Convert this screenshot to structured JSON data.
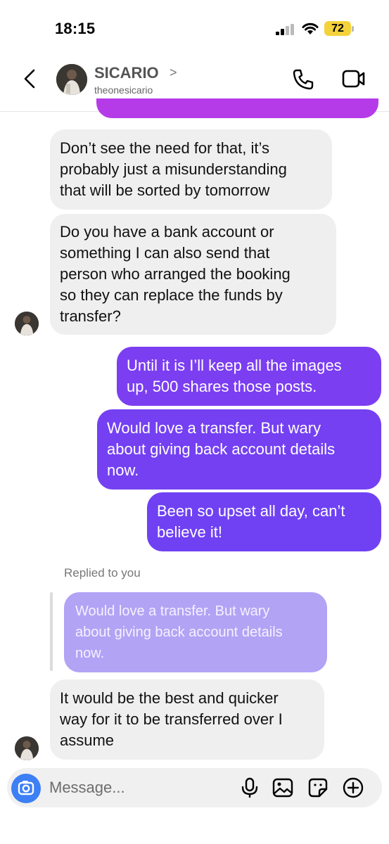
{
  "status_bar": {
    "time": "18:15",
    "battery": "72"
  },
  "header": {
    "name": "SICARIO",
    "chevron": ">",
    "username": "theonesicario"
  },
  "messages": [
    {
      "from": "them",
      "text": "Don’t see the need for that, it’s\nprobably just a misunderstanding\nthat will be sorted by tomorrow"
    },
    {
      "from": "them",
      "text": "Do you have a bank account or\nsomething I can also send that\nperson who arranged the booking\nso they can replace the funds by\ntransfer?"
    },
    {
      "from": "me",
      "text": "Until it is I’ll keep all the images\nup, 500 shares those posts."
    },
    {
      "from": "me",
      "text": "Would love a transfer. But wary\nabout giving back account details\nnow."
    },
    {
      "from": "me",
      "text": "Been so upset all day, can’t\nbelieve it!"
    },
    {
      "from": "them",
      "text": "It would be the best and quicker\nway for it to be transferred over I\nassume"
    }
  ],
  "reply": {
    "label": "Replied to you",
    "quoted_text": "Would love a transfer. But wary\nabout giving back account details\nnow."
  },
  "composer": {
    "placeholder": "Message..."
  },
  "colors": {
    "outgoing": "#7a3cf0",
    "incoming": "#efefef",
    "quote": "#b2a3f5",
    "camera": "#3d7ff5"
  },
  "icons": [
    "back-chevron-icon",
    "phone-icon",
    "video-camera-icon",
    "camera-icon",
    "microphone-icon",
    "gallery-icon",
    "sticker-icon",
    "plus-icon"
  ]
}
